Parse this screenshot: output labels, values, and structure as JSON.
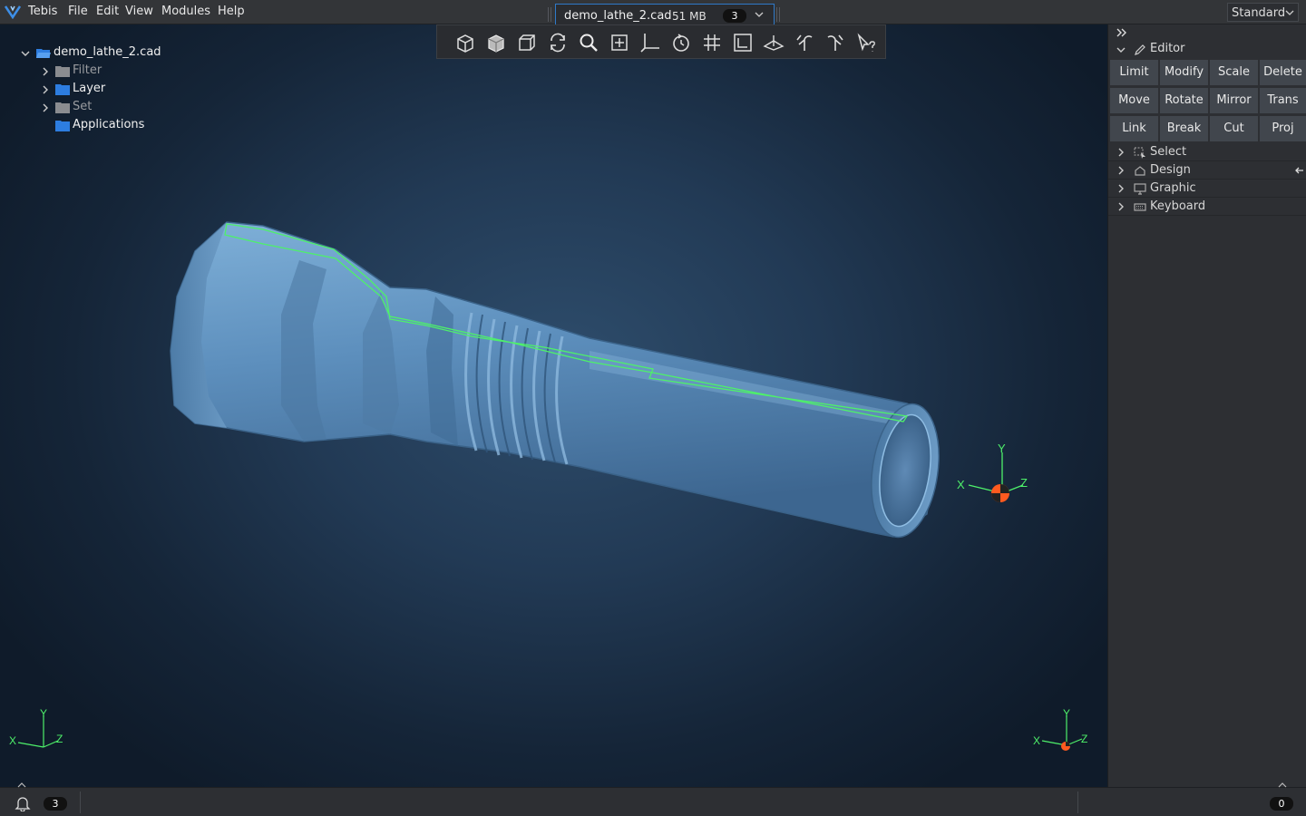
{
  "menubar": {
    "items": [
      "Tebis",
      "File",
      "Edit",
      "View",
      "Modules",
      "Help"
    ],
    "profile": "Standard"
  },
  "document_tab": {
    "title": "demo_lathe_2.cad",
    "size": "51 MB",
    "count": "3"
  },
  "view_toolbar": {
    "icons": [
      "iso-view-icon",
      "shaded-cube-icon",
      "front-view-icon",
      "rotate-refresh-icon",
      "zoom-icon",
      "pan-fit-icon",
      "axes-icon",
      "orbit-icon",
      "grid-icon",
      "frame-icon",
      "plane-icon",
      "undo-view-icon",
      "redo-view-icon",
      "pointer-help-icon"
    ]
  },
  "tree": {
    "root": "demo_lathe_2.cad",
    "items": [
      {
        "label": "Filter",
        "color": "#8a8c90"
      },
      {
        "label": "Layer",
        "color": "#2d7de0"
      },
      {
        "label": "Set",
        "color": "#8a8c90"
      },
      {
        "label": "Applications",
        "color": "#2d7de0"
      }
    ]
  },
  "axis": {
    "x": "X",
    "y": "Y",
    "z": "Z"
  },
  "editor": {
    "title": "Editor",
    "buttons": [
      [
        "Limit",
        "Modify",
        "Scale",
        "Delete"
      ],
      [
        "Move",
        "Rotate",
        "Mirror",
        "Trans"
      ],
      [
        "Link",
        "Break",
        "Cut",
        "Proj"
      ]
    ]
  },
  "panel_sections": [
    "Select",
    "Design",
    "Graphic",
    "Keyboard"
  ],
  "status": {
    "left_count": "3",
    "right_count": "0"
  }
}
